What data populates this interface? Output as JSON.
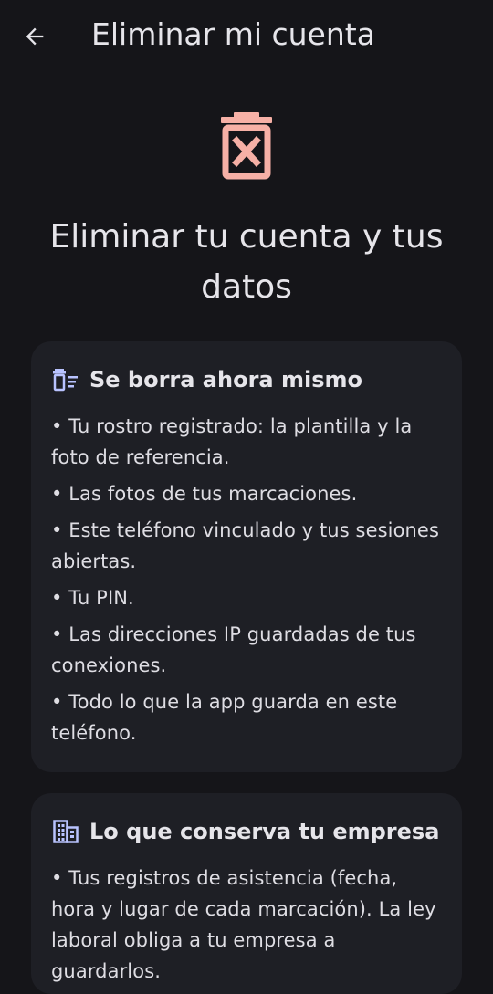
{
  "header": {
    "title": "Eliminar mi cuenta",
    "back_icon": "arrow-back-icon"
  },
  "hero": {
    "icon": "trash-x-icon",
    "icon_color": "#f6b0a6",
    "headline": "Eliminar tu cuenta y tus datos"
  },
  "deleted_card": {
    "icon": "delete-sweep-icon",
    "icon_color": "#b9c3ff",
    "title": "Se borra ahora mismo",
    "items": [
      "• Tu rostro registrado: la plantilla y la foto de referencia.",
      "• Las fotos de tus marcaciones.",
      "• Este teléfono vinculado y tus sesiones abiertas.",
      "• Tu PIN.",
      "• Las direcciones IP guardadas de tus conexiones.",
      "• Todo lo que la app guarda en este teléfono."
    ]
  },
  "kept_card": {
    "icon": "business-icon",
    "icon_color": "#b9c3ff",
    "title": "Lo que conserva tu empresa",
    "items": [
      "• Tus registros de asistencia (fecha, hora y lugar de cada marcación). La ley laboral obliga a tu empresa a guardarlos."
    ]
  }
}
